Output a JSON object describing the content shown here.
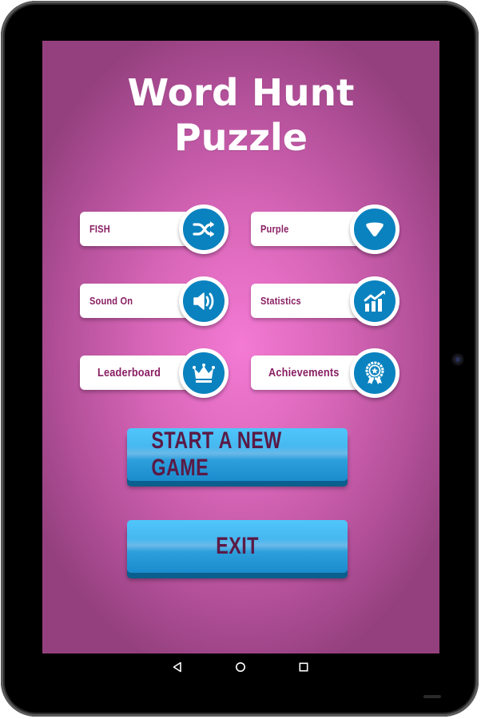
{
  "title": {
    "line1": "Word Hunt",
    "line2": "Puzzle"
  },
  "options": [
    {
      "label": "FISH",
      "icon": "shuffle-icon"
    },
    {
      "label": "Purple",
      "icon": "shield-icon"
    },
    {
      "label": "Sound On",
      "icon": "speaker-icon"
    },
    {
      "label": "Statistics",
      "icon": "chart-icon"
    },
    {
      "label": "Leaderboard",
      "icon": "crown-icon"
    },
    {
      "label": "Achievements",
      "icon": "badge-icon"
    }
  ],
  "buttons": {
    "start": "START A NEW GAME",
    "exit": "EXIT"
  },
  "nav": {
    "back": "back-icon",
    "home": "home-icon",
    "recents": "recents-icon"
  },
  "colors": {
    "accent": "#0a82bf",
    "label": "#8a1f63",
    "button_text": "#5a1a45",
    "background_center": "#f47ad4",
    "background_edge": "#94407e"
  }
}
